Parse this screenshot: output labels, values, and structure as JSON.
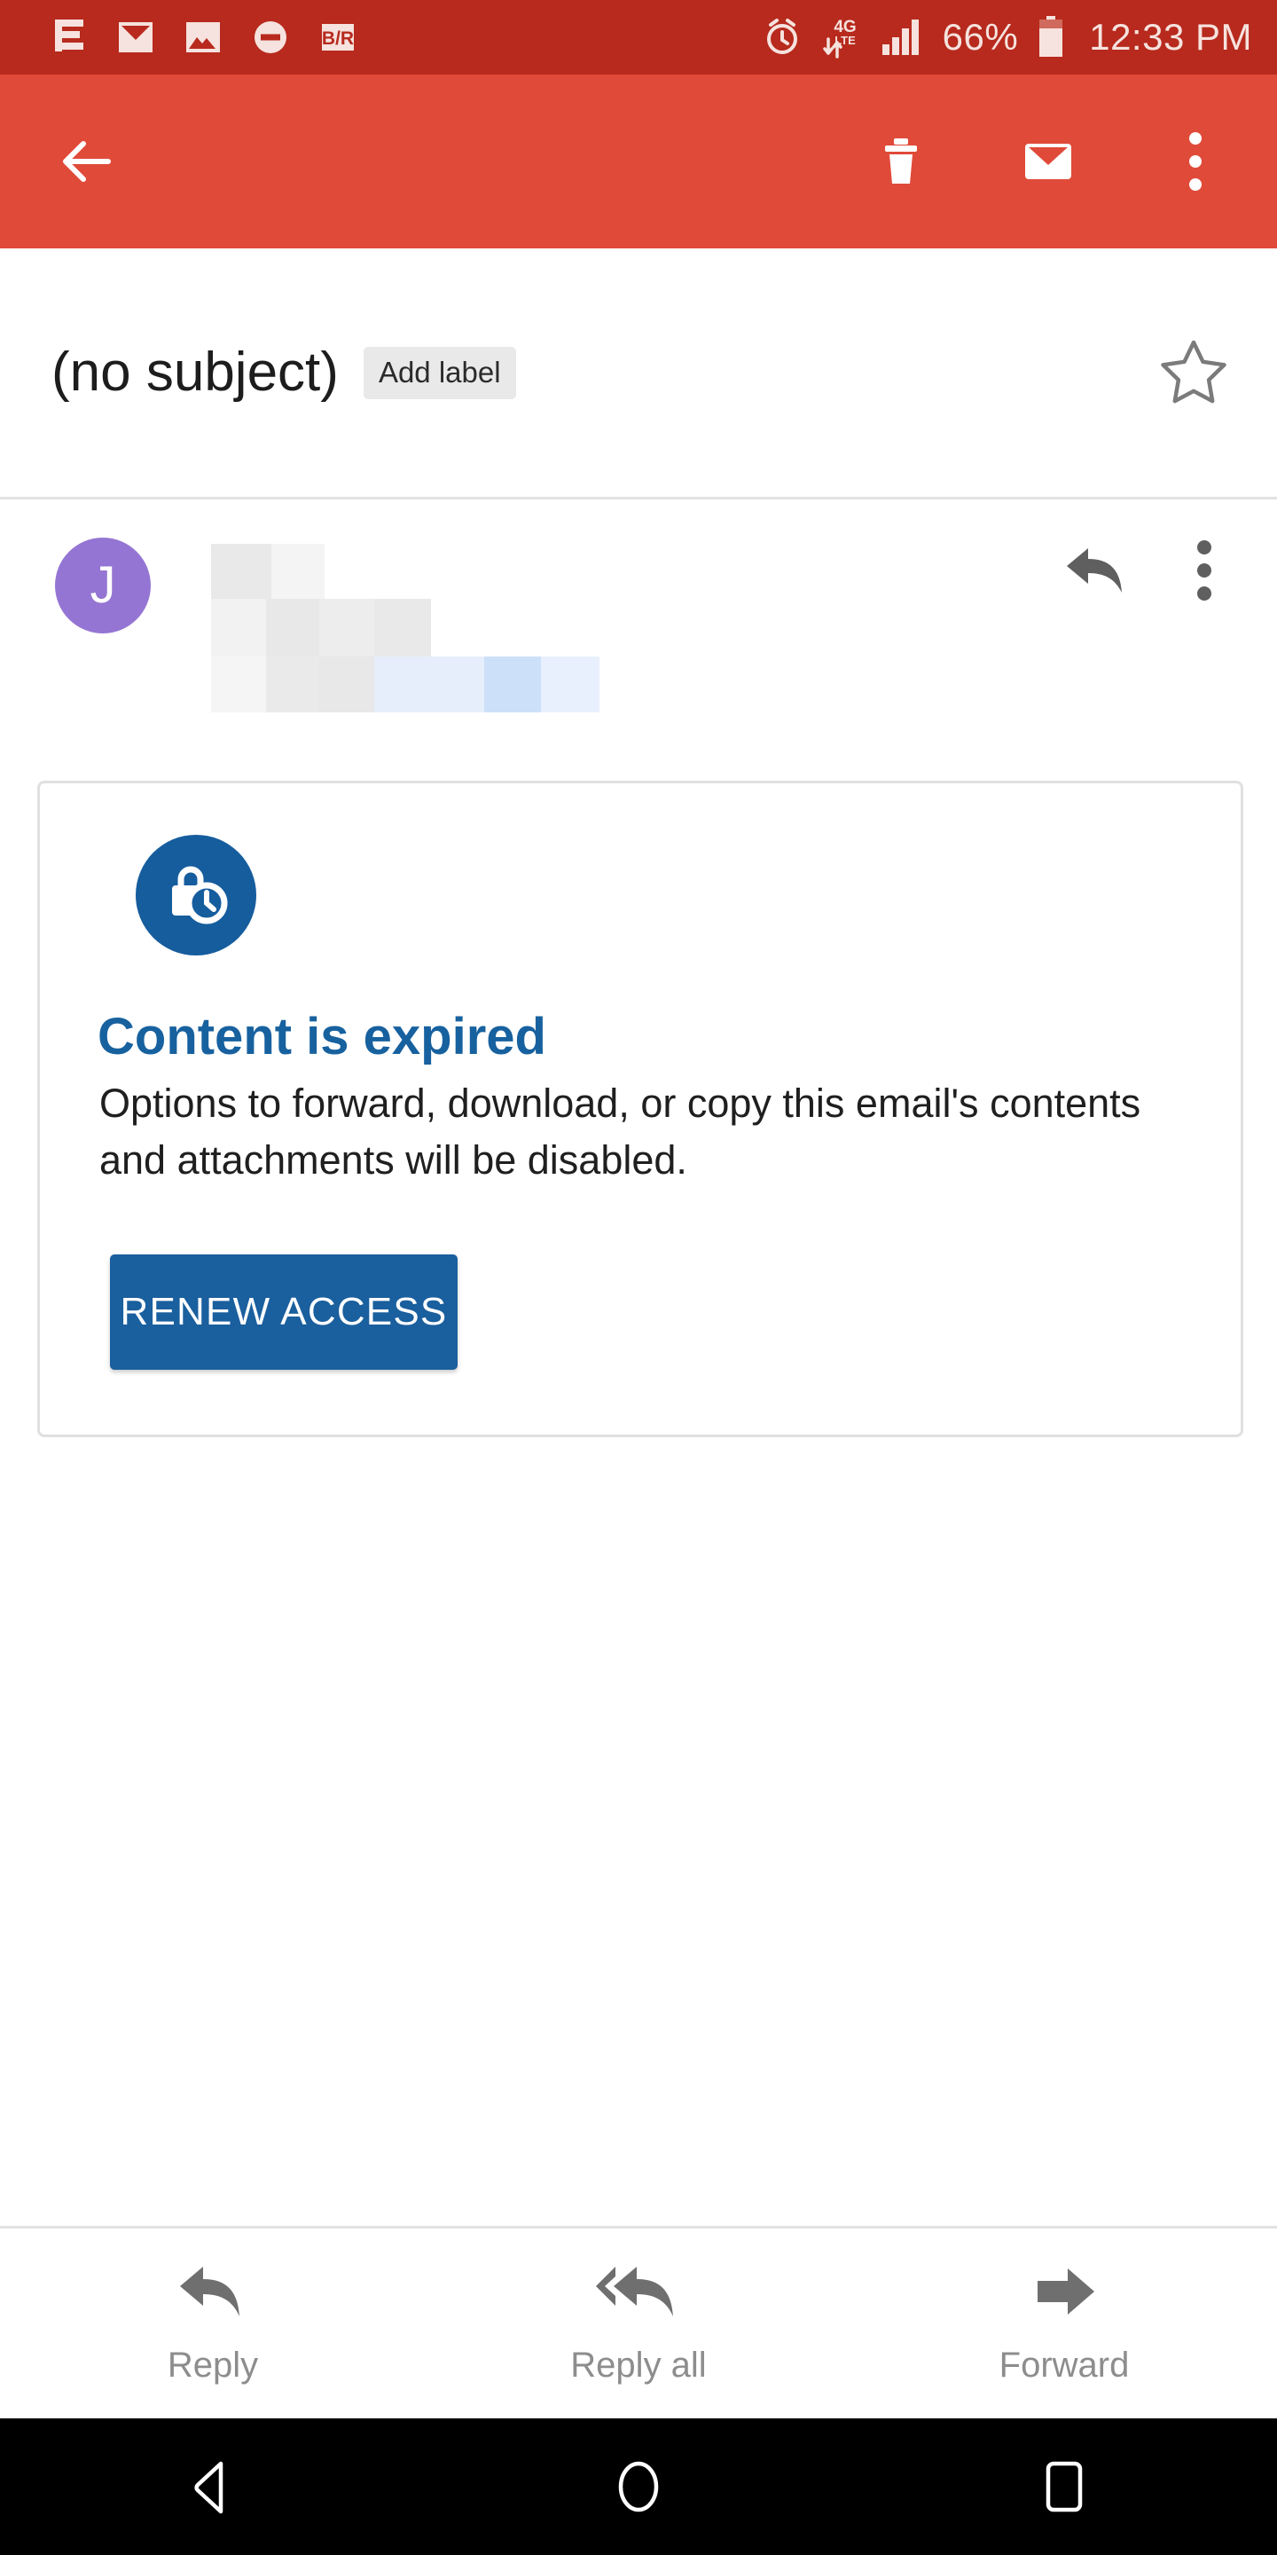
{
  "status_bar": {
    "background_color": "#b72a1d",
    "left_icons": [
      "notification-list-icon",
      "email-icon",
      "photo-icon",
      "do-not-disturb-icon",
      "bleacher-report-icon"
    ],
    "network_type": "4G LTE",
    "battery_percent": "66%",
    "time": "12:33 PM",
    "right_icons": [
      "alarm-icon",
      "network-4glte-icon",
      "signal-bars-icon",
      "battery-icon"
    ]
  },
  "toolbar": {
    "background_color": "#e04a39",
    "back_label": "Back",
    "delete_label": "Delete",
    "mark_unread_label": "Mark as unread",
    "overflow_label": "More options"
  },
  "subject": {
    "text": "(no subject)",
    "add_label_chip": "Add label",
    "starred": false,
    "star_label": "Star"
  },
  "message": {
    "avatar_letter": "J",
    "avatar_color": "#9575d3",
    "sender_redacted": true,
    "reply_label": "Reply",
    "more_label": "More options"
  },
  "expired_card": {
    "icon": "lock-clock-icon",
    "icon_bg_color": "#165d9e",
    "title": "Content is expired",
    "title_color": "#17619f",
    "body": "Options to forward, download, or copy this email's contents and attachments will be disabled.",
    "button_label": "RENEW ACCESS",
    "button_color": "#1a5f9e"
  },
  "action_bar": {
    "items": [
      {
        "label": "Reply",
        "icon": "reply-arrow-icon"
      },
      {
        "label": "Reply all",
        "icon": "reply-all-arrow-icon"
      },
      {
        "label": "Forward",
        "icon": "forward-arrow-icon"
      }
    ]
  },
  "nav_bar": {
    "background_color": "#000000",
    "back_label": "Back",
    "home_label": "Home",
    "recents_label": "Recent apps"
  }
}
